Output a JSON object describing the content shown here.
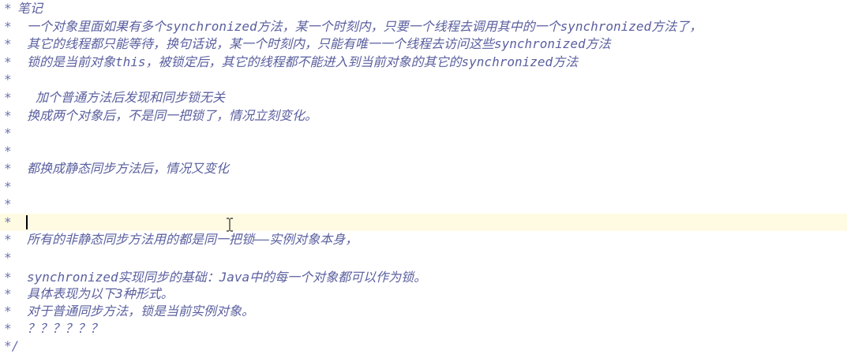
{
  "editor": {
    "lines": [
      {
        "star": "*",
        "text": "笔记"
      },
      {
        "star": "*",
        "text": "一个对象里面如果有多个synchronized方法，某一个时刻内，只要一个线程去调用其中的一个synchronized方法了，"
      },
      {
        "star": "*",
        "text": "其它的线程都只能等待，换句话说，某一个时刻内，只能有唯一一个线程去访问这些synchronized方法"
      },
      {
        "star": "*",
        "text": "锁的是当前对象this，被锁定后，其它的线程都不能进入到当前对象的其它的synchronized方法"
      },
      {
        "star": "*",
        "text": ""
      },
      {
        "star": "*",
        "text": "加个普通方法后发现和同步锁无关"
      },
      {
        "star": "*",
        "text": "换成两个对象后，不是同一把锁了，情况立刻变化。"
      },
      {
        "star": "*",
        "text": ""
      },
      {
        "star": "*",
        "text": ""
      },
      {
        "star": "*",
        "text": "都换成静态同步方法后，情况又变化"
      },
      {
        "star": "*",
        "text": ""
      },
      {
        "star": "*",
        "text": ""
      },
      {
        "star": "*",
        "text": ""
      },
      {
        "star": "*",
        "text": "所有的非静态同步方法用的都是同一把锁——实例对象本身，"
      },
      {
        "star": "*",
        "text": ""
      },
      {
        "star": "*",
        "text": "synchronized实现同步的基础：Java中的每一个对象都可以作为锁。"
      },
      {
        "star": "*",
        "text": "具体表现为以下3种形式。"
      },
      {
        "star": "*",
        "text": "对于普通同步方法，锁是当前实例对象。"
      },
      {
        "star": "*",
        "text": "？？？？？？"
      },
      {
        "star": "*/",
        "text": ""
      }
    ]
  }
}
